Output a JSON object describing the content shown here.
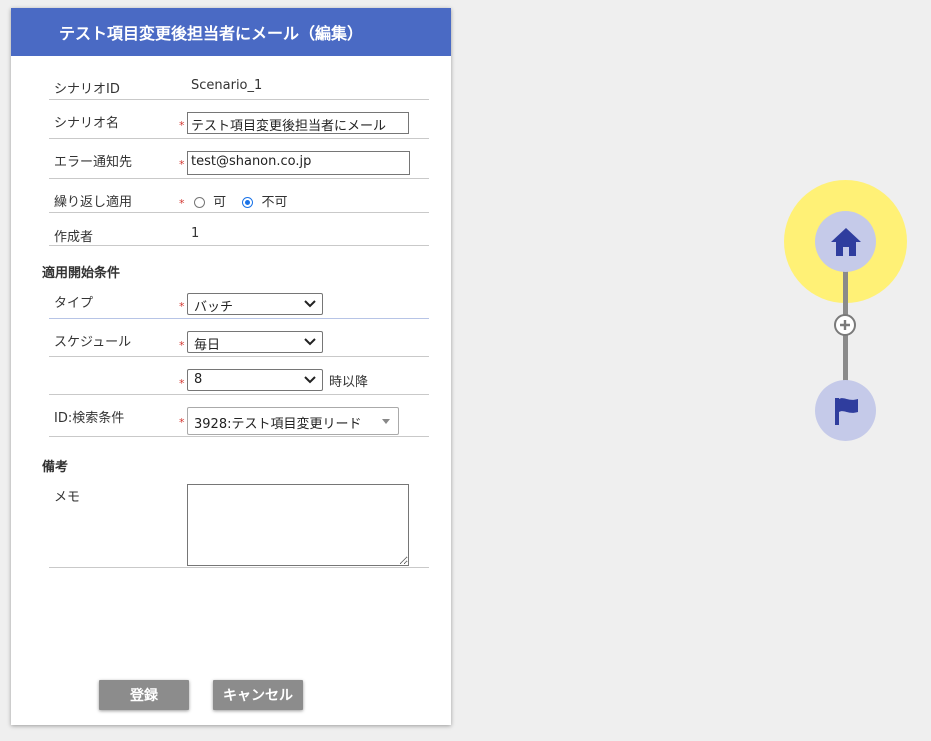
{
  "dialog": {
    "title": "テスト項目変更後担当者にメール（編集）",
    "fields": {
      "scenario_id_label": "シナリオID",
      "scenario_id_value": "Scenario_1",
      "scenario_name_label": "シナリオ名",
      "scenario_name_value": "テスト項目変更後担当者にメール",
      "error_notify_label": "エラー通知先",
      "error_notify_value": "test@shanon.co.jp",
      "repeat_label": "繰り返し適用",
      "repeat_option_yes": "可",
      "repeat_option_no": "不可",
      "repeat_selected": "不可",
      "creator_label": "作成者",
      "creator_value": "1"
    },
    "start_conditions": {
      "heading": "適用開始条件",
      "type_label": "タイプ",
      "type_value": "バッチ",
      "schedule_label": "スケジュール",
      "schedule_value": "毎日",
      "hour_value": "8",
      "hour_suffix": "時以降",
      "search_label": "ID:検索条件",
      "search_value": "3928:テスト項目変更リード"
    },
    "notes": {
      "heading": "備考",
      "memo_label": "メモ",
      "memo_value": ""
    },
    "required_mark": "*",
    "buttons": {
      "register": "登録",
      "cancel": "キャンセル"
    }
  },
  "flow": {
    "nodes": [
      "home-icon",
      "plus-icon",
      "flag-icon"
    ],
    "highlight_color": "#fff176",
    "node_color": "#c5cae9",
    "icon_color": "#2f3d9e"
  }
}
